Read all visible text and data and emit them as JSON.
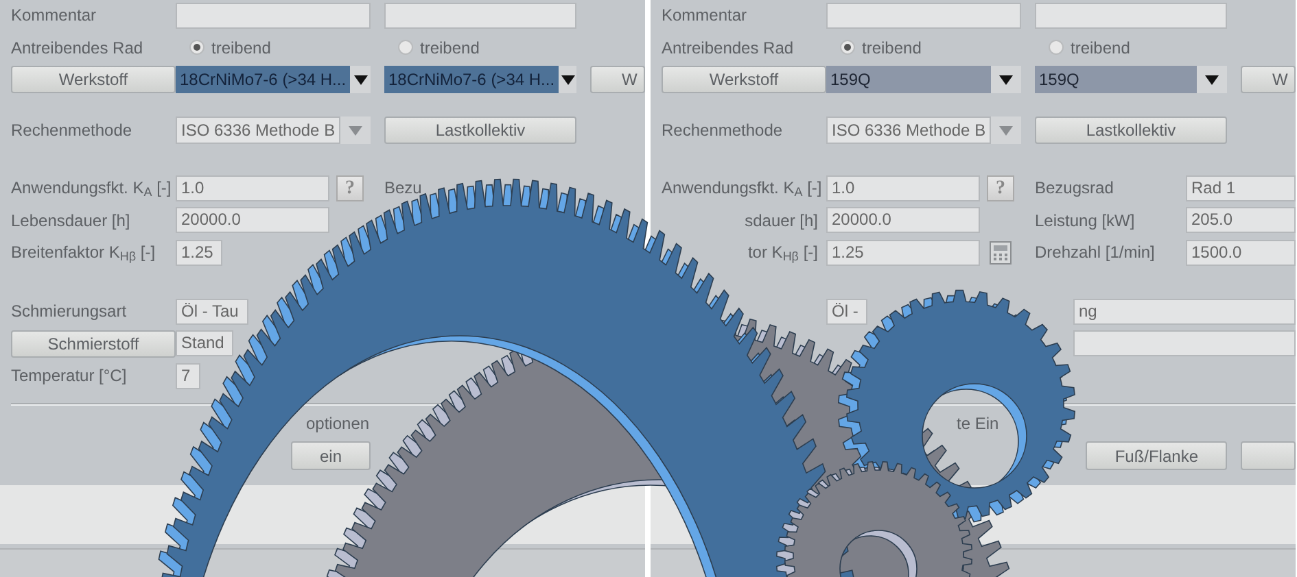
{
  "panels": [
    {
      "groups": [
        [
          {
            "kind": "pair",
            "cells": [
              {
                "kind": "label",
                "text": "Kommentar"
              },
              {
                "kind": "field"
              },
              {
                "kind": "field"
              }
            ]
          },
          {
            "kind": "radio",
            "cells": [
              {
                "kind": "label",
                "text": "Antreibendes Rad"
              },
              {
                "kind": "radio",
                "text": "treibend",
                "selected": true
              },
              {
                "kind": "radio",
                "text": "treibend",
                "selected": false
              }
            ]
          },
          {
            "kind": "material",
            "cells": [
              {
                "kind": "button",
                "text": "Werkstoff"
              },
              {
                "kind": "select",
                "text": "18CrNiMo7-6 (>34 H...",
                "highlighted": true,
                "disabled": false
              },
              {
                "kind": "select",
                "text": "18CrNiMo7-6 (>34 H...",
                "highlighted": true,
                "disabled": false
              },
              {
                "kind": "cut-button",
                "text": "W"
              }
            ]
          }
        ],
        [
          {
            "kind": "method",
            "cells": [
              {
                "kind": "label",
                "text": "Rechenmethode"
              },
              {
                "kind": "select",
                "text": "ISO 6336 Methode B",
                "disabled": true
              },
              {
                "kind": "button",
                "text": "Lastkollektiv"
              }
            ]
          }
        ],
        [
          {
            "kind": "param",
            "cells": [
              {
                "kind": "label",
                "text": "Anwendungsfkt. K$_{A}$ [-]"
              },
              {
                "kind": "field",
                "value": "1.0"
              },
              {
                "kind": "help-button",
                "text": "?"
              },
              {
                "kind": "label",
                "text": "Bezu"
              }
            ]
          },
          {
            "kind": "param",
            "cells": [
              {
                "kind": "label",
                "text": "Lebensdauer [h]"
              },
              {
                "kind": "field",
                "value": "20000.0"
              }
            ]
          },
          {
            "kind": "param",
            "cells": [
              {
                "kind": "label",
                "text": "Breitenfaktor K$_{Hβ}$ [-]"
              },
              {
                "kind": "cut-field",
                "value": "1.25"
              }
            ]
          }
        ],
        [
          {
            "kind": "wide",
            "cells": [
              {
                "kind": "label",
                "text": "Schmierungsart"
              },
              {
                "kind": "cut-field",
                "value": "Öl - Tau"
              }
            ]
          },
          {
            "kind": "wide",
            "cells": [
              {
                "kind": "button",
                "text": "Schmierstoff"
              },
              {
                "kind": "cut-field",
                "value": "Stand"
              }
            ]
          },
          {
            "kind": "wide",
            "cells": [
              {
                "kind": "label",
                "text": "Temperatur [°C]"
              },
              {
                "kind": "cut-field",
                "value": "7"
              }
            ]
          }
        ]
      ],
      "options": {
        "label": "optionen",
        "buttons": [
          {
            "kind": "cut-button",
            "text": "ein"
          }
        ]
      }
    },
    {
      "groups": [
        [
          {
            "kind": "pair",
            "cells": [
              {
                "kind": "label",
                "text": "Kommentar"
              },
              {
                "kind": "field"
              },
              {
                "kind": "field"
              }
            ]
          },
          {
            "kind": "radio",
            "cells": [
              {
                "kind": "label",
                "text": "Antreibendes Rad"
              },
              {
                "kind": "radio",
                "text": "treibend",
                "selected": true
              },
              {
                "kind": "radio",
                "text": "treibend",
                "selected": false
              }
            ]
          },
          {
            "kind": "material",
            "cells": [
              {
                "kind": "button",
                "text": "Werkstoff"
              },
              {
                "kind": "select",
                "text": "159Q",
                "highlighted": false,
                "disabled": false
              },
              {
                "kind": "select",
                "text": "159Q",
                "highlighted": false,
                "disabled": false
              },
              {
                "kind": "cut-button",
                "text": "W"
              }
            ]
          }
        ],
        [
          {
            "kind": "method",
            "cells": [
              {
                "kind": "label",
                "text": "Rechenmethode"
              },
              {
                "kind": "select",
                "text": "ISO 6336 Methode B",
                "disabled": true
              },
              {
                "kind": "button",
                "text": "Lastkollektiv"
              }
            ]
          }
        ],
        [
          {
            "kind": "param",
            "cells": [
              {
                "kind": "label",
                "text": "Anwendungsfkt. K$_{A}$ [-]"
              },
              {
                "kind": "field",
                "value": "1.0"
              },
              {
                "kind": "help-button",
                "text": "?"
              },
              {
                "kind": "label",
                "text": "Bezugsrad"
              },
              {
                "kind": "field",
                "value": "Rad 1"
              }
            ]
          },
          {
            "kind": "param",
            "cells": [
              {
                "kind": "cut-label",
                "text": "sdauer [h]"
              },
              {
                "kind": "field",
                "value": "20000.0"
              },
              {
                "kind": "label",
                "text": "Leistung [kW]"
              },
              {
                "kind": "field",
                "value": "205.0"
              }
            ]
          },
          {
            "kind": "param",
            "cells": [
              {
                "kind": "cut-label",
                "text": "tor K$_{Hβ}$ [-]"
              },
              {
                "kind": "field",
                "value": "1.25"
              },
              {
                "kind": "calc-button"
              },
              {
                "kind": "label",
                "text": "Drehzahl [1/min]"
              },
              {
                "kind": "field",
                "value": "1500.0"
              }
            ]
          }
        ],
        [
          {
            "kind": "wide",
            "cells": [
              {
                "kind": "cut-field",
                "value": "Öl -"
              },
              {
                "kind": "tail-field",
                "value": "ng"
              }
            ]
          },
          {
            "kind": "wide",
            "cells": [
              {
                "kind": "tail-field"
              }
            ]
          }
        ]
      ],
      "options": {
        "label": "te Ein",
        "buttons": [
          {
            "kind": "cut-button",
            "text": "Fuß/Flanke"
          },
          {
            "kind": "button"
          }
        ]
      }
    }
  ]
}
